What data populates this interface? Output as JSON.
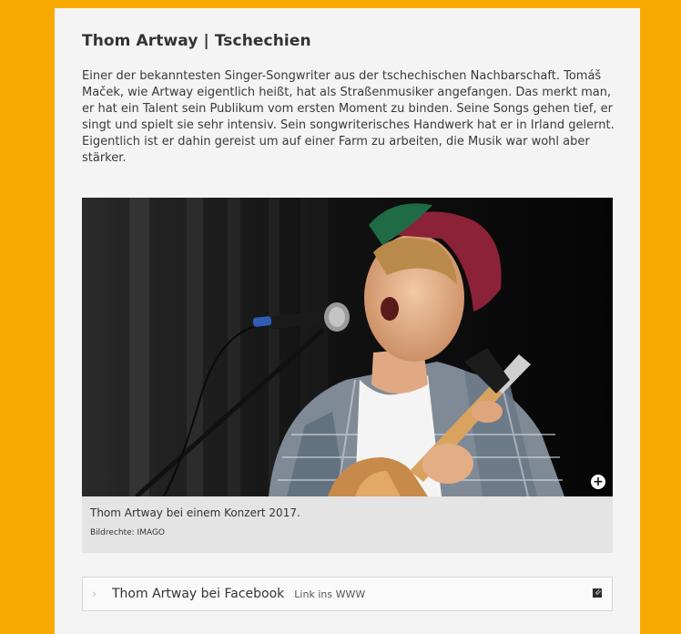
{
  "article": {
    "title": "Thom Artway | Tschechien",
    "body": "Einer der bekanntesten Singer-Songwriter aus der tschechischen Nachbarschaft. Tomáš Maček, wie Artway eigentlich heißt, hat als Straßenmusiker angefangen. Das merkt man, er hat ein Talent sein Publikum vom ersten Moment zu binden. Seine Songs gehen tief, er singt und spielt sie sehr intensiv. Sein songwriterisches Handwerk hat er in Irland gelernt. Eigentlich ist er dahin gereist um auf einer Farm zu arbeiten, die Musik war wohl aber stärker."
  },
  "figure": {
    "caption": "Thom Artway bei einem Konzert 2017.",
    "credit": "Bildrechte: IMAGO",
    "zoom_icon": "+"
  },
  "link": {
    "chevron": "›",
    "label": "Thom Artway bei Facebook",
    "sublabel": "Link ins WWW",
    "icon": "external-link-icon"
  },
  "colors": {
    "frame": "#f8a900",
    "panel": "#f4f4f4",
    "caption_bg": "#e4e4e4"
  }
}
